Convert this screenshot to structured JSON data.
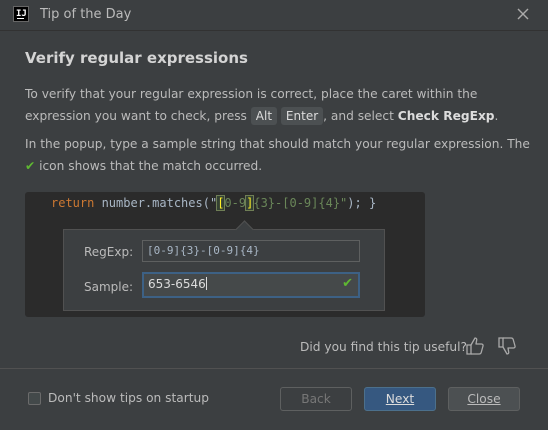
{
  "window": {
    "title": "Tip of the Day",
    "app_icon_text": "IJ"
  },
  "tip": {
    "heading": "Verify regular expressions",
    "p1_before": "To verify that your regular expression is correct, place the caret within the expression you want to check, press ",
    "key1": "Alt",
    "key2": "Enter",
    "p1_middle": ", and select ",
    "p1_action": "Check RegExp",
    "p1_end": ".",
    "p2_before": "In the popup, type a sample string that should match your regular expression. The ",
    "p2_icon": "✔",
    "p2_after": " icon shows that the match occurred."
  },
  "demo": {
    "code_keyword": "return",
    "code_call": " number.matches(\"",
    "code_hl": "[",
    "code_rx_1": "0-9",
    "code_hl2": "]",
    "code_rx_2": "{3}-[0-9]{4}",
    "code_end_str": "\"",
    "code_end": "); }",
    "regexp_label": "RegExp:",
    "regexp_value": "[0-9]{3}-[0-9]{4}",
    "sample_label": "Sample:",
    "sample_value": "653-6546",
    "match_icon": "check-icon"
  },
  "feedback": {
    "question": "Did you find this tip useful?",
    "thumbs_up_icon": "thumbs-up-icon",
    "thumbs_down_icon": "thumbs-down-icon"
  },
  "footer": {
    "checkbox_label": "Don't show tips on startup",
    "checkbox_checked": false,
    "back_label": "Back",
    "next_label": "Next",
    "close_label": "Close"
  },
  "colors": {
    "accent": "#365880",
    "match": "#5fb832",
    "background": "#3c3f41"
  }
}
